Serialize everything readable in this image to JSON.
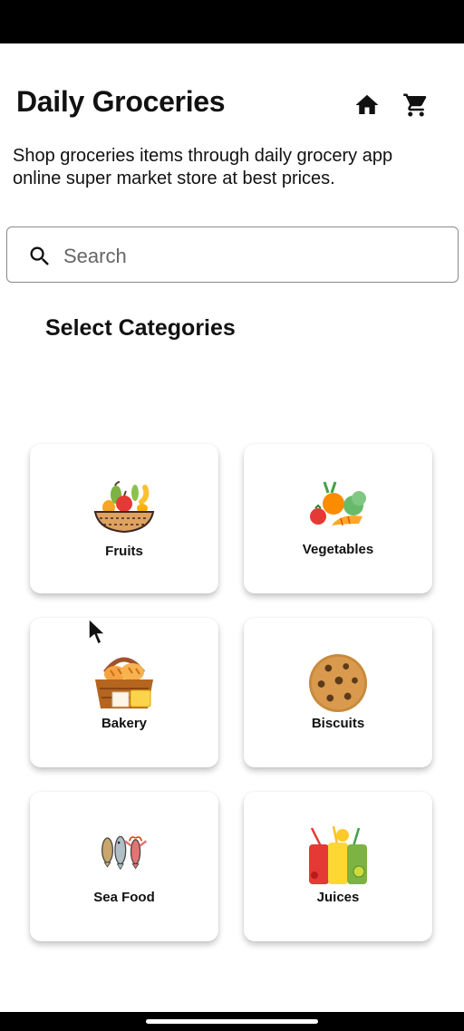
{
  "header": {
    "title": "Daily Groceries",
    "subtitle": "Shop groceries items through daily grocery app online super market store at best prices.",
    "icons": [
      "home-icon",
      "cart-icon"
    ]
  },
  "search": {
    "placeholder": "Search",
    "value": "",
    "icon": "search-icon"
  },
  "section": {
    "title": "Select Categories"
  },
  "categories": [
    {
      "label": "Fruits",
      "icon": "fruit-basket-icon"
    },
    {
      "label": "Vegetables",
      "icon": "vegetables-icon"
    },
    {
      "label": "Bakery",
      "icon": "bread-basket-icon"
    },
    {
      "label": "Biscuits",
      "icon": "cookie-icon"
    },
    {
      "label": "Sea Food",
      "icon": "seafood-icon"
    },
    {
      "label": "Juices",
      "icon": "juice-glasses-icon"
    }
  ]
}
